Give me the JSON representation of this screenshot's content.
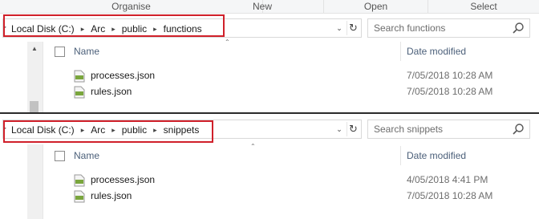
{
  "ribbon": {
    "groups": [
      "Organise",
      "New",
      "Open",
      "Select"
    ]
  },
  "pane1": {
    "breadcrumb": [
      "Local Disk (C:)",
      "Arc",
      "public",
      "functions"
    ],
    "search_placeholder": "Search functions",
    "columns": {
      "name": "Name",
      "date": "Date modified"
    },
    "files": [
      {
        "name": "processes.json",
        "date": "7/05/2018 10:28 AM"
      },
      {
        "name": "rules.json",
        "date": "7/05/2018 10:28 AM"
      }
    ]
  },
  "pane2": {
    "breadcrumb": [
      "Local Disk (C:)",
      "Arc",
      "public",
      "snippets"
    ],
    "search_placeholder": "Search snippets",
    "columns": {
      "name": "Name",
      "date": "Date modified"
    },
    "files": [
      {
        "name": "processes.json",
        "date": "4/05/2018 4:41 PM"
      },
      {
        "name": "rules.json",
        "date": "7/05/2018 10:28 AM"
      }
    ]
  },
  "icons": {
    "separator": "chevron-right-icon",
    "dropdown": "chevron-down-icon",
    "refresh": "refresh-icon",
    "search": "search-icon",
    "file": "json-file-icon",
    "sort": "sort-up-icon"
  },
  "colors": {
    "highlight": "#d0202a",
    "header_text": "#4c607a",
    "date_text": "#6d6d6d"
  }
}
